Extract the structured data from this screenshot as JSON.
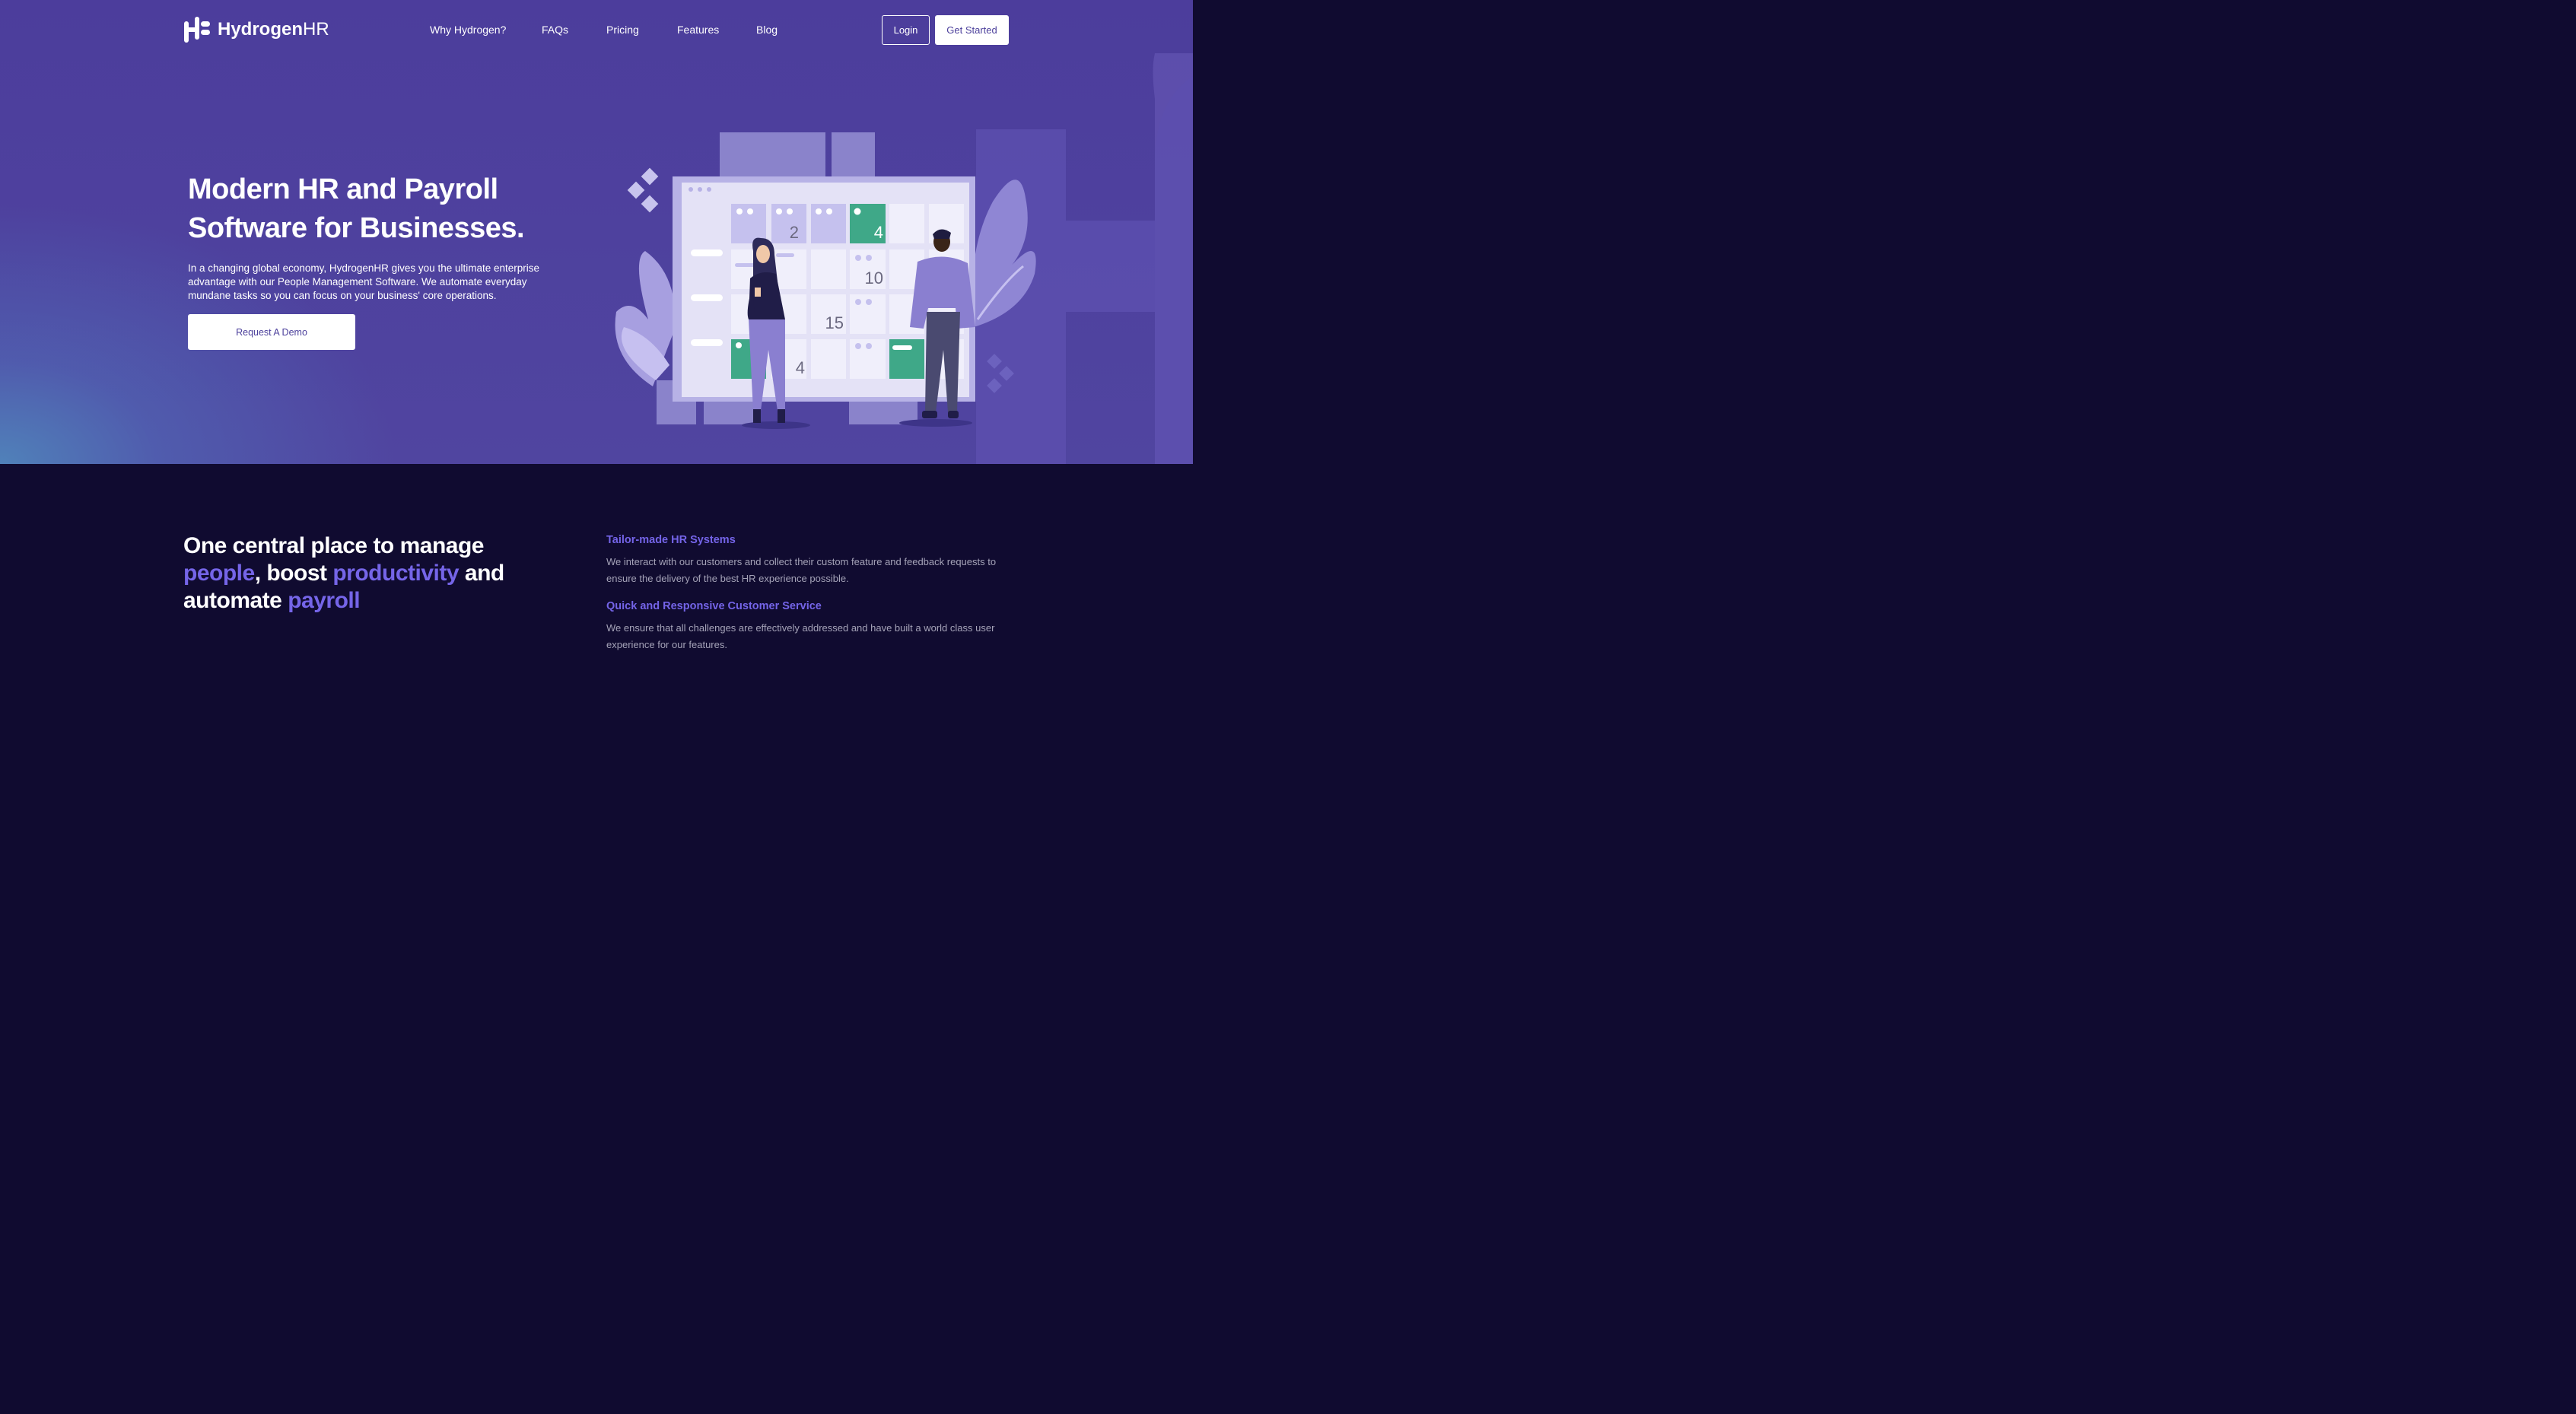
{
  "brand": {
    "name_bold": "Hydrogen",
    "name_light": "HR"
  },
  "nav": {
    "items": [
      {
        "label": "Why Hydrogen?"
      },
      {
        "label": "FAQs"
      },
      {
        "label": "Pricing"
      },
      {
        "label": "Features"
      },
      {
        "label": "Blog"
      }
    ],
    "login_label": "Login",
    "get_started_label": "Get Started"
  },
  "hero": {
    "title": "Modern HR and Payroll Software for Businesses.",
    "description": "In a changing global economy, HydrogenHR gives you the ultimate enterprise advantage with our People Management Software. We automate everyday mundane tasks so you can focus on your business' core operations.",
    "cta_label": "Request A Demo",
    "calendar_numbers": [
      "2",
      "4",
      "10",
      "15",
      "4"
    ]
  },
  "intro": {
    "t1": "One central place to manage",
    "h1": "people",
    "t2": ", boost",
    "h2": "productivity",
    "t3": " and automate",
    "h3": "payroll"
  },
  "features": [
    {
      "title": "Tailor-made HR Systems",
      "description": "We interact with our customers and collect their custom feature and feedback requests to ensure the delivery of the best HR experience possible."
    },
    {
      "title": "Quick and Responsive Customer Service",
      "description": "We ensure that all challenges are effectively addressed and have built a world class user experience for our features."
    }
  ],
  "colors": {
    "hero_bg": "#4f43a0",
    "dark_bg": "#100b30",
    "accent": "#7565e8",
    "calendar_green": "#3fa888"
  }
}
